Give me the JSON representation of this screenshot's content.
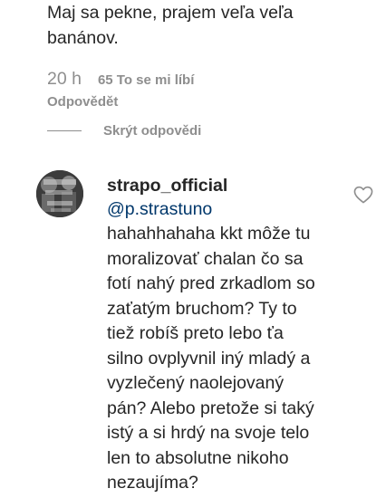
{
  "parent_comment": {
    "text": "Maj sa pekne, prajem veľa veľa\nbanánov.",
    "time": "20 h",
    "likes": "65 To se mi líbí",
    "reply_label": "Odpovědět",
    "hide_replies_label": "Skrýt odpovědi"
  },
  "reply": {
    "username": "strapo_official",
    "mention": "@p.strastuno",
    "text": "hahahhahaha kkt môže tu\nmoralizovať chalan čo sa\nfotí nahý pred zrkadlom so\nzaťatým bruchom? Ty to\ntiež robíš preto lebo ťa\nsilno ovplyvnil iný mladý a\nvyzlečený naolejovaný\npán? Alebo pretože si taký\nistý a si hrdý na svoje telo\nlen to absolutne nikoho\nnezaujíma?",
    "avatar_icon": "profile-photo",
    "like_icon": "heart-outline-icon"
  },
  "colors": {
    "text": "#262626",
    "meta": "#8e8e8e",
    "mention": "#00376b"
  }
}
